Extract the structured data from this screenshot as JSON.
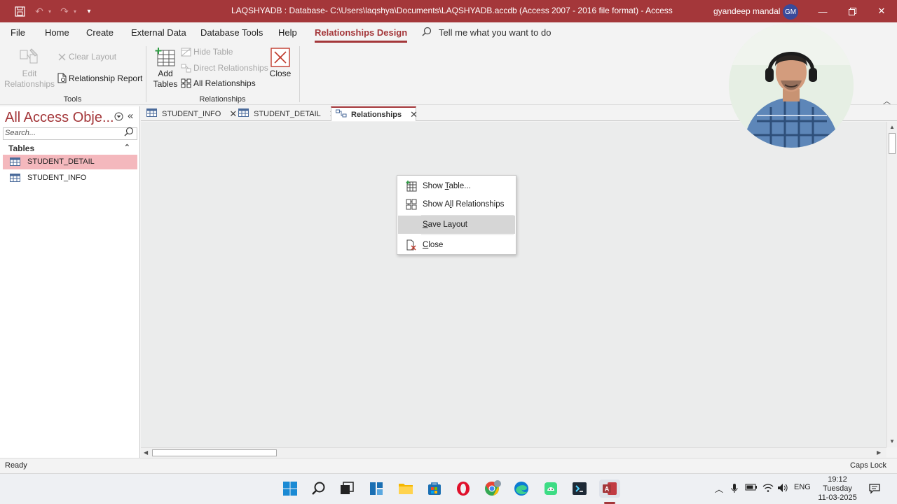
{
  "title_bar": {
    "window_title": "LAQSHYADB : Database- C:\\Users\\laqshya\\Documents\\LAQSHYADB.accdb (Access 2007 - 2016 file format)  -  Access",
    "user_name": "gyandeep mandal",
    "user_initials": "GM",
    "quick_access": [
      "save-icon",
      "undo-icon",
      "redo-icon",
      "customize-icon"
    ],
    "accent_color": "#a4373a"
  },
  "ribbon_tabs": [
    "File",
    "Home",
    "Create",
    "External Data",
    "Database Tools",
    "Help",
    "Relationships Design"
  ],
  "active_ribbon_tab": "Relationships Design",
  "tell_me": "Tell me what you want to do",
  "ribbon": {
    "tools": {
      "edit_relationships_line1": "Edit",
      "edit_relationships_line2": "Relationships",
      "clear_layout": "Clear Layout",
      "relationship_report": "Relationship Report",
      "group_label": "Tools"
    },
    "relationships": {
      "add_tables_line1": "Add",
      "add_tables_line2": "Tables",
      "hide_table": "Hide Table",
      "direct_relationships": "Direct Relationships",
      "all_relationships": "All Relationships",
      "close": "Close",
      "group_label": "Relationships"
    }
  },
  "nav_pane": {
    "title": "All Access Obje...",
    "search_placeholder": "Search...",
    "group": "Tables",
    "items": [
      "STUDENT_DETAIL",
      "STUDENT_INFO"
    ],
    "selected": "STUDENT_DETAIL",
    "selection_color": "#f4b8bd"
  },
  "doc_tabs": [
    {
      "label": "STUDENT_INFO",
      "active": false
    },
    {
      "label": "STUDENT_DETAIL",
      "active": false
    },
    {
      "label": "Relationships",
      "active": true
    }
  ],
  "context_menu": {
    "items": [
      {
        "pre": "Show ",
        "ul": "T",
        "post": "able..."
      },
      {
        "pre": "Show A",
        "ul": "l",
        "post": "l Relationships"
      },
      {
        "pre": "",
        "ul": "S",
        "post": "ave Layout"
      },
      {
        "pre": "",
        "ul": "C",
        "post": "lose"
      }
    ],
    "highlighted": "Save Layout"
  },
  "status_bar": {
    "left": "Ready",
    "right": "Caps Lock"
  },
  "taskbar": {
    "apps": [
      "windows-start-icon",
      "search-icon",
      "task-view-icon",
      "widgets-icon",
      "file-explorer-icon",
      "store-icon",
      "opera-icon",
      "chrome-icon",
      "edge-icon",
      "android-icon",
      "terminal-icon",
      "access-icon"
    ],
    "language": "ENG",
    "time": "19:12",
    "day": "Tuesday",
    "date": "11-03-2025"
  }
}
